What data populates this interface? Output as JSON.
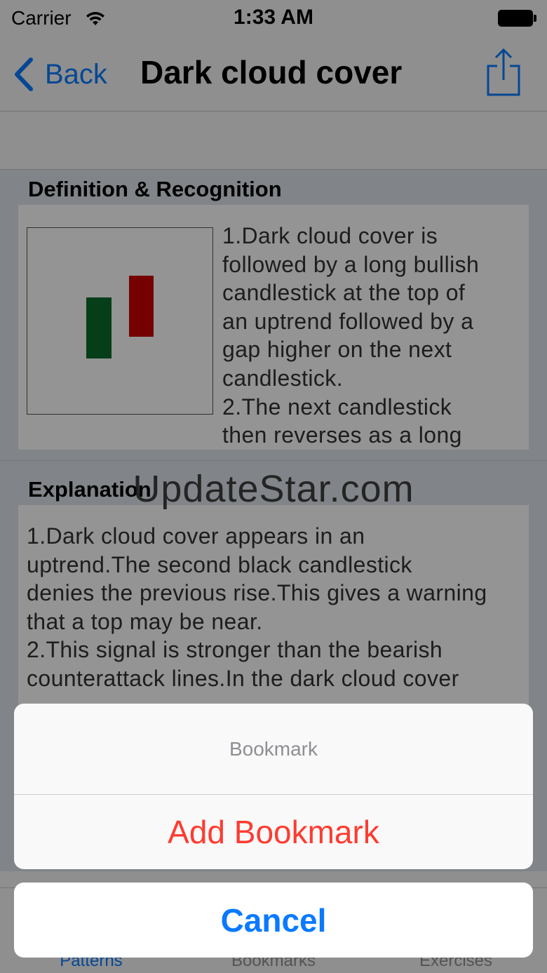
{
  "status_bar": {
    "carrier": "Carrier",
    "time": "1:33 AM"
  },
  "nav": {
    "back_label": "Back",
    "title": "Dark cloud cover",
    "share_icon": "share-icon"
  },
  "sections": {
    "definition": {
      "header": "Definition & Recognition",
      "lines": [
        "1.Dark cloud cover is",
        "followed by a long bullish",
        "candlestick at the top of",
        "an uptrend followed by a",
        "gap higher on the next",
        "candlestick.",
        "2.The next candlestick",
        "then reverses as a long"
      ]
    },
    "explanation": {
      "header": "Explanation",
      "lines": [
        "1.Dark cloud cover appears in an",
        "uptrend.The second black candlestick",
        "denies the previous rise.This gives a warning",
        "that a top may be near.",
        "2.This signal is stronger than the bearish",
        "counterattack lines.In the dark cloud cover"
      ]
    }
  },
  "candles": {
    "bull_color": "#0b6b2b",
    "bear_color": "#c80000"
  },
  "tabs": [
    {
      "label": "Patterns",
      "active": true
    },
    {
      "label": "Bookmarks",
      "active": false
    },
    {
      "label": "Exercises",
      "active": false
    }
  ],
  "action_sheet": {
    "title": "Bookmark",
    "action": "Add Bookmark",
    "cancel": "Cancel"
  },
  "watermark": "UpdateStar.com",
  "colors": {
    "accent": "#0a7aff",
    "destructive": "#ff3b30"
  }
}
